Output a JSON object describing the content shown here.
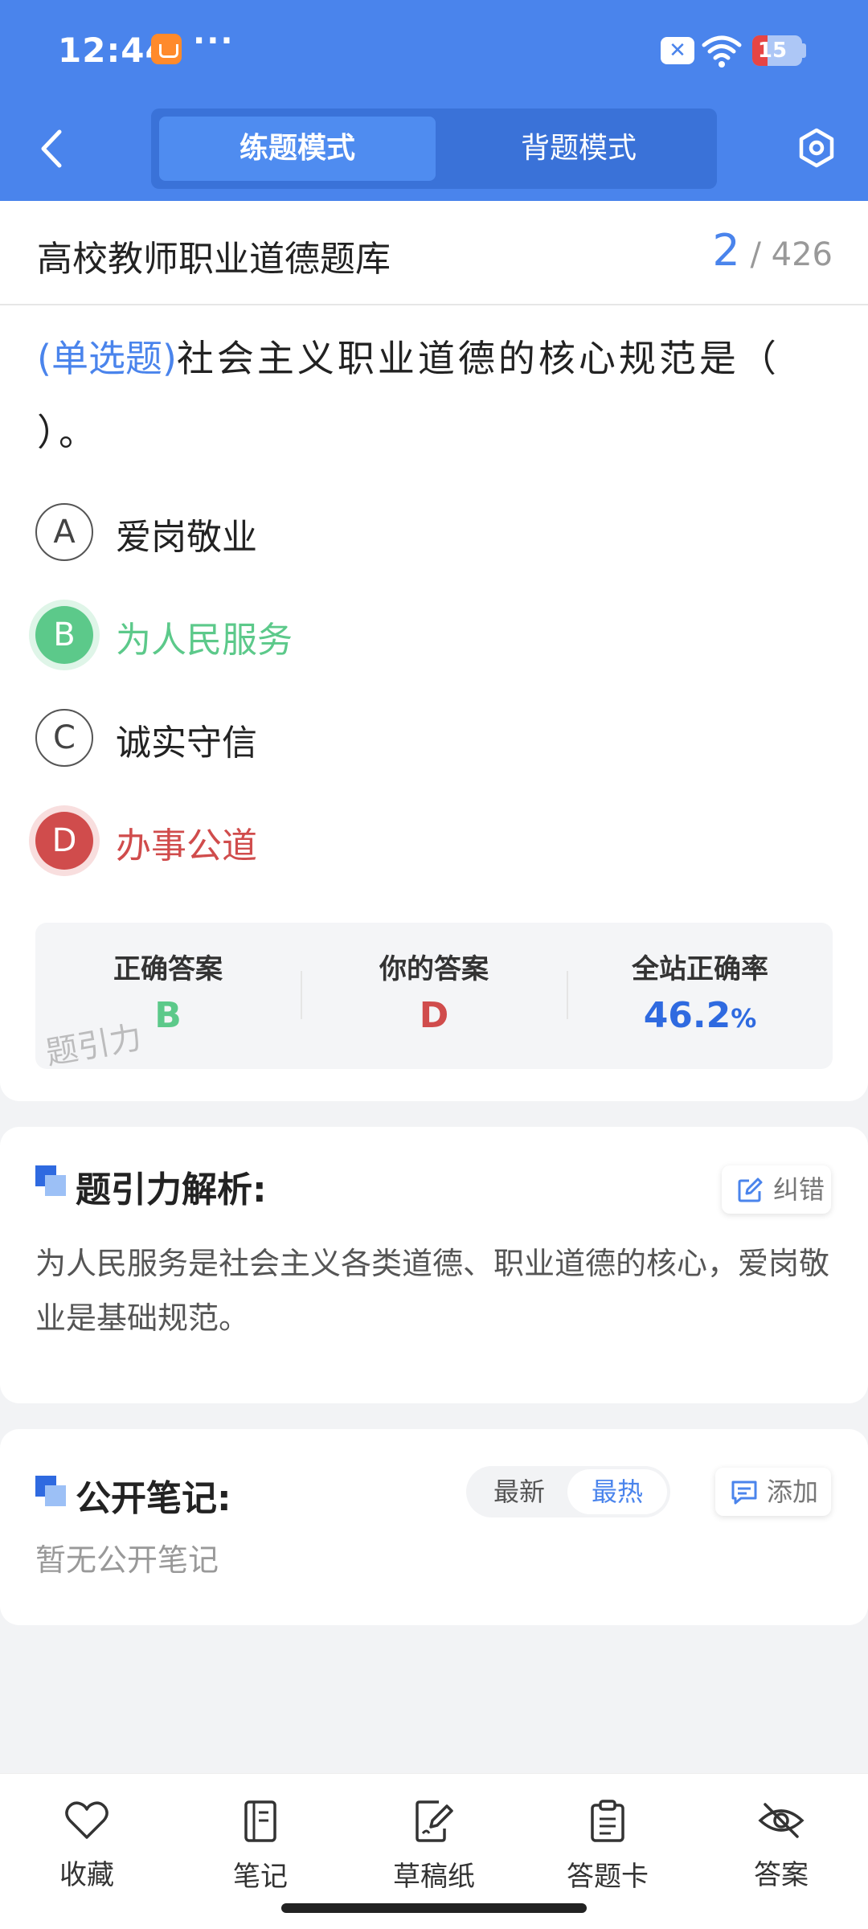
{
  "status_bar": {
    "time": "12:44",
    "more": "···",
    "battery_level": "15",
    "battery_fraction": 0.15
  },
  "header": {
    "modes": [
      "练题模式",
      "背题模式"
    ],
    "active_mode": 0
  },
  "question_bank": {
    "title": "高校教师职业道德题库",
    "current": "2",
    "separator": "/",
    "total": "426"
  },
  "question": {
    "type": "(单选题)",
    "text": "社会主义职业道德的核心规范是（ ）。",
    "options": [
      {
        "letter": "A",
        "text": "爱岗敬业",
        "state": "normal"
      },
      {
        "letter": "B",
        "text": "为人民服务",
        "state": "correct"
      },
      {
        "letter": "C",
        "text": "诚实守信",
        "state": "normal"
      },
      {
        "letter": "D",
        "text": "办事公道",
        "state": "wrong"
      }
    ]
  },
  "answer_summary": {
    "correct_label": "正确答案",
    "correct_value": "B",
    "yours_label": "你的答案",
    "yours_value": "D",
    "rate_label": "全站正确率",
    "rate_value": "46.2",
    "rate_unit": "%",
    "watermark": "题引力"
  },
  "analysis": {
    "title": "题引力解析:",
    "report_label": "纠错",
    "text": "为人民服务是社会主义各类道德、职业道德的核心，爱岗敬业是基础规范。"
  },
  "notes": {
    "title": "公开笔记:",
    "sort_options": [
      "最新",
      "最热"
    ],
    "active_sort": 1,
    "add_label": "添加",
    "empty_text": "暂无公开笔记"
  },
  "bottom_nav": [
    {
      "label": "收藏",
      "icon": "heart-icon"
    },
    {
      "label": "笔记",
      "icon": "notebook-icon"
    },
    {
      "label": "草稿纸",
      "icon": "draft-paper-icon"
    },
    {
      "label": "答题卡",
      "icon": "clipboard-icon"
    },
    {
      "label": "答案",
      "icon": "eye-off-icon"
    }
  ],
  "colors": {
    "header": "#4a84ec",
    "accent": "#4a84ec",
    "correct": "#5cc98a",
    "wrong": "#d04c4c"
  }
}
